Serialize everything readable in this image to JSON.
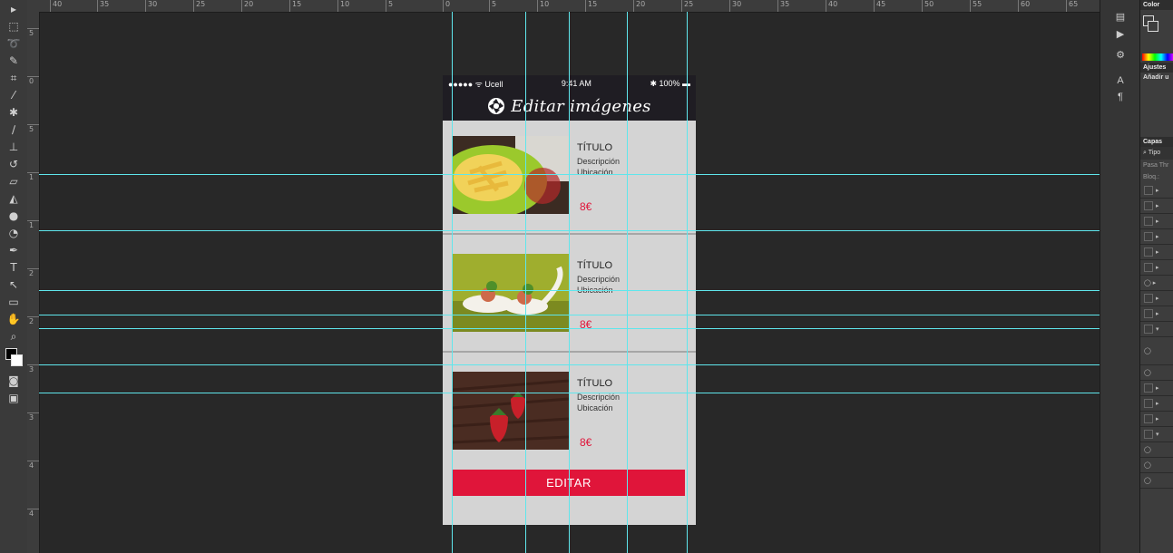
{
  "ruler_top": [
    "40",
    "35",
    "30",
    "25",
    "20",
    "15",
    "10",
    "5",
    "0",
    "5",
    "10",
    "15",
    "20",
    "25",
    "30",
    "35",
    "40",
    "45",
    "50",
    "55",
    "60",
    "65"
  ],
  "ruler_left": [
    "5",
    "0",
    "5",
    "1",
    "1",
    "2",
    "2",
    "3",
    "3",
    "4",
    "4"
  ],
  "toolbar_icons": [
    "move-icon",
    "marquee-icon",
    "lasso-icon",
    "quick-select-icon",
    "crop-icon",
    "eyedropper-icon",
    "healing-brush-icon",
    "brush-icon",
    "clone-stamp-icon",
    "history-brush-icon",
    "eraser-icon",
    "paint-bucket-icon",
    "blur-icon",
    "dodge-icon",
    "pen-icon",
    "type-icon",
    "path-select-icon",
    "rectangle-icon",
    "hand-icon",
    "zoom-icon"
  ],
  "right_panel": {
    "color_header": "Color",
    "adjust_header": "Ajustes",
    "adjust_sub": "Añadir u",
    "layers_header": "Capas",
    "layers_filter": "Tipo",
    "layers_blend": "Pasa Thr",
    "layers_lock": "Bloq.:"
  },
  "phone": {
    "carrier": "●●●●● ᯤ Ucell",
    "time": "9:41 AM",
    "battery": "✱ 100% ▬",
    "app_title": "Editar imágenes",
    "items": [
      {
        "title": "TÍTULO",
        "desc": "Descripción",
        "loc": "Ubicación",
        "price": "8€"
      },
      {
        "title": "TÍTULO",
        "desc": "Descripción",
        "loc": "Ubicación",
        "price": "8€"
      },
      {
        "title": "TÍTULO",
        "desc": "Descripción",
        "loc": "Ubicación",
        "price": "8€"
      }
    ],
    "edit_button": "EDITAR"
  },
  "colors": {
    "accent": "#e0153a",
    "guide": "#5fe6ec",
    "header": "#1f1d23"
  }
}
